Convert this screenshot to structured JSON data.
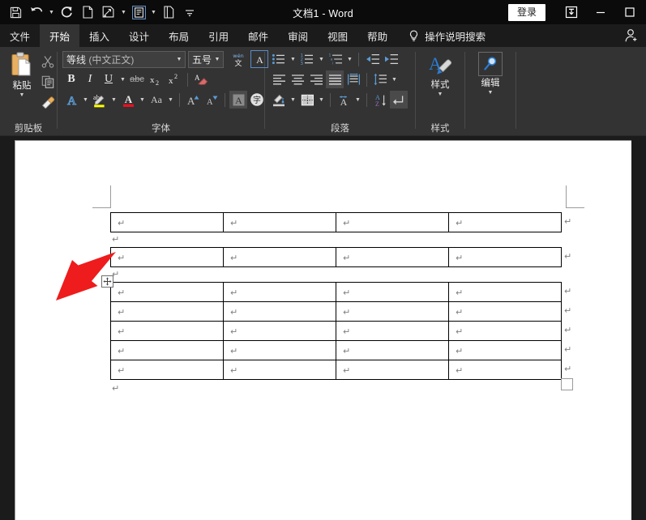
{
  "titlebar": {
    "document_title": "文档1  -  Word",
    "signin_label": "登录",
    "quick_access": [
      {
        "name": "save-icon",
        "label": "保存"
      },
      {
        "name": "undo-icon",
        "label": "撤消"
      },
      {
        "name": "redo-icon",
        "label": "恢复"
      },
      {
        "name": "new-document-icon",
        "label": "新建"
      },
      {
        "name": "quick-print-icon",
        "label": "快速打印"
      },
      {
        "name": "print-preview-icon",
        "label": "打印预览"
      },
      {
        "name": "open-icon",
        "label": "打开"
      },
      {
        "name": "customize-qat-icon",
        "label": "自定义快速访问工具栏"
      }
    ],
    "window_buttons": [
      {
        "name": "ribbon-display-options-icon",
        "label": "功能区显示选项"
      },
      {
        "name": "minimize-icon",
        "label": "最小化"
      },
      {
        "name": "maximize-icon",
        "label": "最大化"
      }
    ]
  },
  "tabs": [
    {
      "label": "文件",
      "active": false
    },
    {
      "label": "开始",
      "active": true
    },
    {
      "label": "插入",
      "active": false
    },
    {
      "label": "设计",
      "active": false
    },
    {
      "label": "布局",
      "active": false
    },
    {
      "label": "引用",
      "active": false
    },
    {
      "label": "邮件",
      "active": false
    },
    {
      "label": "审阅",
      "active": false
    },
    {
      "label": "视图",
      "active": false
    },
    {
      "label": "帮助",
      "active": false
    }
  ],
  "tell_me": {
    "label": "操作说明搜索",
    "icon": "lightbulb-icon"
  },
  "account_icon": "user-account-icon",
  "ribbon": {
    "clipboard": {
      "label": "剪贴板",
      "paste_label": "粘贴",
      "buttons": [
        {
          "name": "cut-button",
          "label": "剪切"
        },
        {
          "name": "copy-button",
          "label": "复制"
        },
        {
          "name": "format-painter-button",
          "label": "格式刷"
        }
      ]
    },
    "font": {
      "label": "字体",
      "font_name": "等线",
      "font_name_suffix": " (中文正文)",
      "font_size": "五号",
      "buttons": [
        {
          "name": "phonetic-guide-button",
          "label": "拼音指南"
        },
        {
          "name": "character-border-button",
          "label": "字符边框"
        },
        {
          "name": "bold-button",
          "label": "B"
        },
        {
          "name": "italic-button",
          "label": "I"
        },
        {
          "name": "underline-button",
          "label": "U"
        },
        {
          "name": "strikethrough-button",
          "label": "abc"
        },
        {
          "name": "subscript-button",
          "label": "x₂"
        },
        {
          "name": "superscript-button",
          "label": "x²"
        },
        {
          "name": "clear-formatting-button",
          "label": "清除所有格式"
        },
        {
          "name": "text-effects-button",
          "label": "文本效果和版式"
        },
        {
          "name": "text-highlight-color-button",
          "label": "文本突出显示颜色"
        },
        {
          "name": "font-color-button",
          "label": "字体颜色"
        },
        {
          "name": "change-case-button",
          "label": "Aa"
        },
        {
          "name": "grow-font-button",
          "label": "增大字号"
        },
        {
          "name": "shrink-font-button",
          "label": "减小字号"
        },
        {
          "name": "character-shading-button",
          "label": "字符底纹"
        },
        {
          "name": "enclose-characters-button",
          "label": "带圈字符"
        }
      ]
    },
    "paragraph": {
      "label": "段落",
      "buttons": [
        {
          "name": "bullets-button",
          "label": "项目符号"
        },
        {
          "name": "numbering-button",
          "label": "编号"
        },
        {
          "name": "multilevel-list-button",
          "label": "多级列表"
        },
        {
          "name": "decrease-indent-button",
          "label": "减少缩进量"
        },
        {
          "name": "increase-indent-button",
          "label": "增加缩进量"
        },
        {
          "name": "align-left-button",
          "label": "左对齐"
        },
        {
          "name": "align-center-button",
          "label": "居中"
        },
        {
          "name": "align-right-button",
          "label": "右对齐"
        },
        {
          "name": "justify-button",
          "label": "两端对齐"
        },
        {
          "name": "distribute-button",
          "label": "分散对齐"
        },
        {
          "name": "line-spacing-button",
          "label": "行和段落间距"
        },
        {
          "name": "shading-button",
          "label": "底纹"
        },
        {
          "name": "borders-button",
          "label": "边框"
        },
        {
          "name": "asian-layout-button",
          "label": "中文版式"
        },
        {
          "name": "sort-button",
          "label": "排序"
        },
        {
          "name": "show-formatting-marks-button",
          "label": "显示/隐藏编辑标记"
        }
      ]
    },
    "styles": {
      "label": "样式",
      "button_label": "样式"
    },
    "editing": {
      "label": "编辑",
      "button_label": "编辑"
    }
  },
  "document": {
    "tables": [
      {
        "name": "table-1",
        "rows": 1,
        "columns": 4,
        "cells": [
          [
            "",
            "",
            "",
            ""
          ]
        ]
      },
      {
        "name": "table-2",
        "rows": 1,
        "columns": 4,
        "cells": [
          [
            "",
            "",
            "",
            ""
          ]
        ]
      },
      {
        "name": "table-3",
        "rows": 5,
        "columns": 4,
        "cells": [
          [
            "",
            "",
            "",
            ""
          ],
          [
            "",
            "",
            "",
            ""
          ],
          [
            "",
            "",
            "",
            ""
          ],
          [
            "",
            "",
            "",
            ""
          ],
          [
            "",
            "",
            "",
            ""
          ]
        ]
      }
    ],
    "paragraph_mark": "↵",
    "annotation": {
      "name": "red-arrow-annotation",
      "color": "#ee1c1c",
      "points_to": "table-move-handle"
    },
    "move_handle_icon": "table-move-handle-icon",
    "end_handle_icon": "table-resize-handle-icon"
  },
  "colors": {
    "titlebar_bg": "#0b0b0b",
    "ribbon_bg": "#333333",
    "tabstrip_bg": "#1b1b1b",
    "accent_blue": "#2b7cd3",
    "page_bg": "#ffffff",
    "annotation_red": "#ee1c1c",
    "highlight_yellow": "#ffff00",
    "font_color_red": "#e81123"
  }
}
